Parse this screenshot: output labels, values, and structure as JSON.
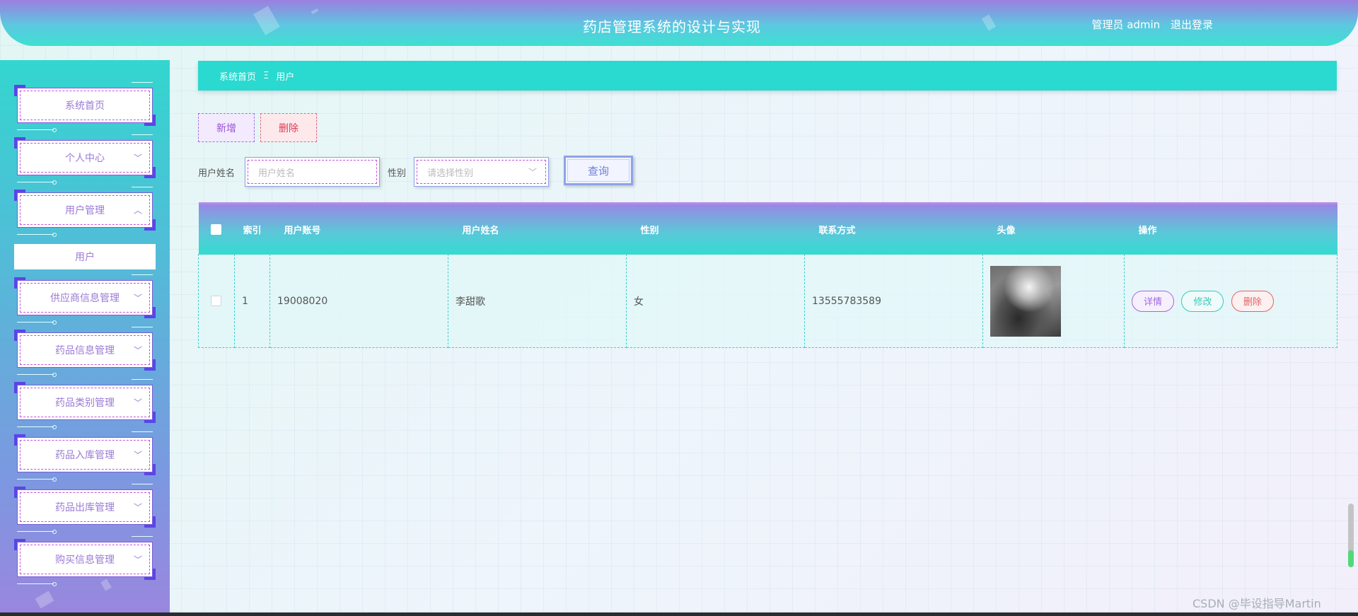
{
  "header": {
    "title": "药店管理系统的设计与实现",
    "user": "管理员 admin",
    "logout": "退出登录"
  },
  "sidebar": {
    "items": [
      {
        "label": "系统首页",
        "chevron": ""
      },
      {
        "label": "个人中心",
        "chevron": "﹀"
      },
      {
        "label": "用户管理",
        "chevron": "︿"
      },
      {
        "label": "供应商信息管理",
        "chevron": "﹀"
      },
      {
        "label": "药品信息管理",
        "chevron": "﹀"
      },
      {
        "label": "药品类别管理",
        "chevron": "﹀"
      },
      {
        "label": "药品入库管理",
        "chevron": "﹀"
      },
      {
        "label": "药品出库管理",
        "chevron": "﹀"
      },
      {
        "label": "购买信息管理",
        "chevron": "﹀"
      }
    ],
    "submenu": {
      "label": "用户"
    }
  },
  "breadcrumb": {
    "home": "系统首页",
    "separator": "Ξ",
    "current": "用户"
  },
  "toolbar": {
    "add_label": "新增",
    "delete_label": "删除"
  },
  "search": {
    "name_label": "用户姓名",
    "name_placeholder": "用户姓名",
    "gender_label": "性别",
    "gender_placeholder": "请选择性别",
    "button_label": "查询"
  },
  "table": {
    "columns": [
      "索引",
      "用户账号",
      "用户姓名",
      "性别",
      "联系方式",
      "头像",
      "操作"
    ],
    "rows": [
      {
        "index": "1",
        "account": "19008020",
        "name": "李甜歌",
        "gender": "女",
        "phone": "13555783589"
      }
    ],
    "actions": {
      "detail": "详情",
      "edit": "修改",
      "remove": "删除"
    }
  },
  "watermark": "CSDN @毕设指导Martin",
  "colors": {
    "accent": "#2ad9cf",
    "purple": "#9a86e6",
    "danger": "#e03a55"
  }
}
